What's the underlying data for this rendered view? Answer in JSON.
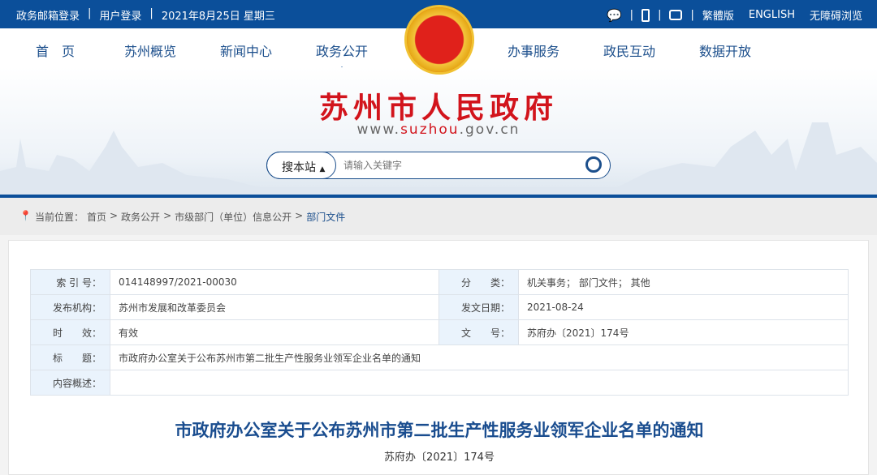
{
  "topbar": {
    "mail_login": "政务邮箱登录",
    "sep": "|",
    "user_login": "用户登录",
    "date": "2021年8月25日 星期三",
    "traditional": "繁體版",
    "english": "ENGLISH",
    "accessible": "无障碍浏览"
  },
  "nav": [
    "首　页",
    "苏州概览",
    "新闻中心",
    "政务公开",
    "办事服务",
    "政民互动",
    "数据开放"
  ],
  "header": {
    "site_title": "苏州市人民政府",
    "url_prefix": "www.",
    "url_domain": "suzhou",
    "url_suffix": ".gov.cn"
  },
  "search": {
    "scope": "搜本站",
    "placeholder": "请输入关键字"
  },
  "breadcrumb": {
    "label": "当前位置：",
    "items": [
      "首页",
      ">",
      "政务公开",
      ">",
      "市级部门（单位）信息公开",
      ">"
    ],
    "current": "部门文件"
  },
  "info": {
    "index_label": "索 引 号：",
    "index": "014148997/2021-00030",
    "category_label": "分　　类：",
    "category": "机关事务； 部门文件； 其他",
    "publisher_label": "发布机构：",
    "publisher": "苏州市发展和改革委员会",
    "date_label": "发文日期：",
    "date": "2021-08-24",
    "validity_label": "时　　效：",
    "validity": "有效",
    "docno_label": "文　　号：",
    "docno": "苏府办〔2021〕174号",
    "title_label": "标　　题：",
    "title": "市政府办公室关于公布苏州市第二批生产性服务业领军企业名单的通知",
    "summary_label": "内容概述：",
    "summary": ""
  },
  "document": {
    "title": "市政府办公室关于公布苏州市第二批生产性服务业领军企业名单的通知",
    "number": "苏府办〔2021〕174号"
  }
}
